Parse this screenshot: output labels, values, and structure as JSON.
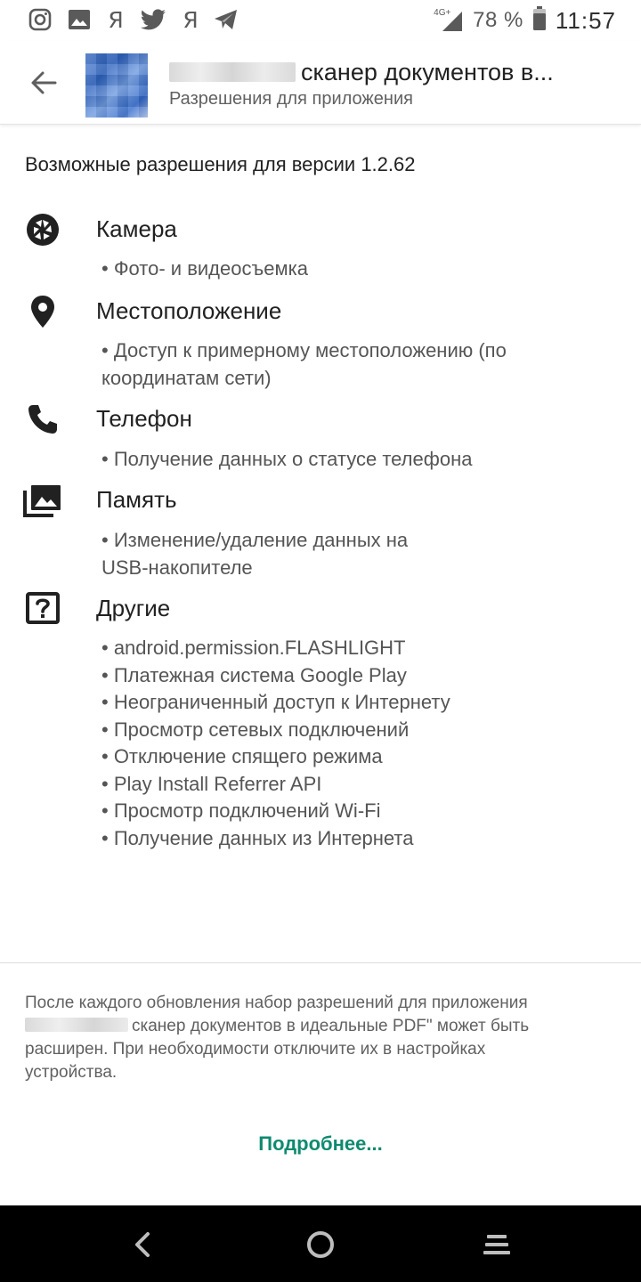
{
  "status_bar": {
    "yandex_1": "Я",
    "yandex_2": "Я",
    "network": "4G+",
    "battery_percent": "78 %",
    "time": "11:57"
  },
  "app_bar": {
    "title": "сканер документов в...",
    "subtitle": "Разрешения для приложения"
  },
  "version_heading": "Возможные разрешения для версии 1.2.62",
  "permissions": [
    {
      "icon": "camera-icon",
      "title": "Камера",
      "items": [
        "• Фото- и видеосъемка"
      ]
    },
    {
      "icon": "location-pin-icon",
      "title": "Местоположение",
      "items": [
        "• Доступ к примерному местоположению (по",
        "координатам сети)"
      ]
    },
    {
      "icon": "phone-icon",
      "title": "Телефон",
      "items": [
        "• Получение данных о статусе телефона"
      ]
    },
    {
      "icon": "photo-library-icon",
      "title": "Память",
      "items": [
        "• Изменение/удаление данных на",
        "USB-накопителе"
      ]
    },
    {
      "icon": "help-box-icon",
      "title": "Другие",
      "items": [
        "• android.permission.FLASHLIGHT",
        "• Платежная система Google Play",
        "• Неограниченный доступ к Интернету",
        "• Просмотр сетевых подключений",
        "• Отключение спящего режима",
        "• Play Install Referrer API",
        "• Просмотр подключений Wi-Fi",
        "• Получение данных из Интернета"
      ]
    }
  ],
  "footer": {
    "line1": "После каждого обновления набор разрешений для приложения",
    "line2": "сканер документов в идеальные PDF\" может быть",
    "line3": "расширен. При необходимости отключите их в настройках",
    "line4": "устройства.",
    "more_link": "Подробнее..."
  }
}
